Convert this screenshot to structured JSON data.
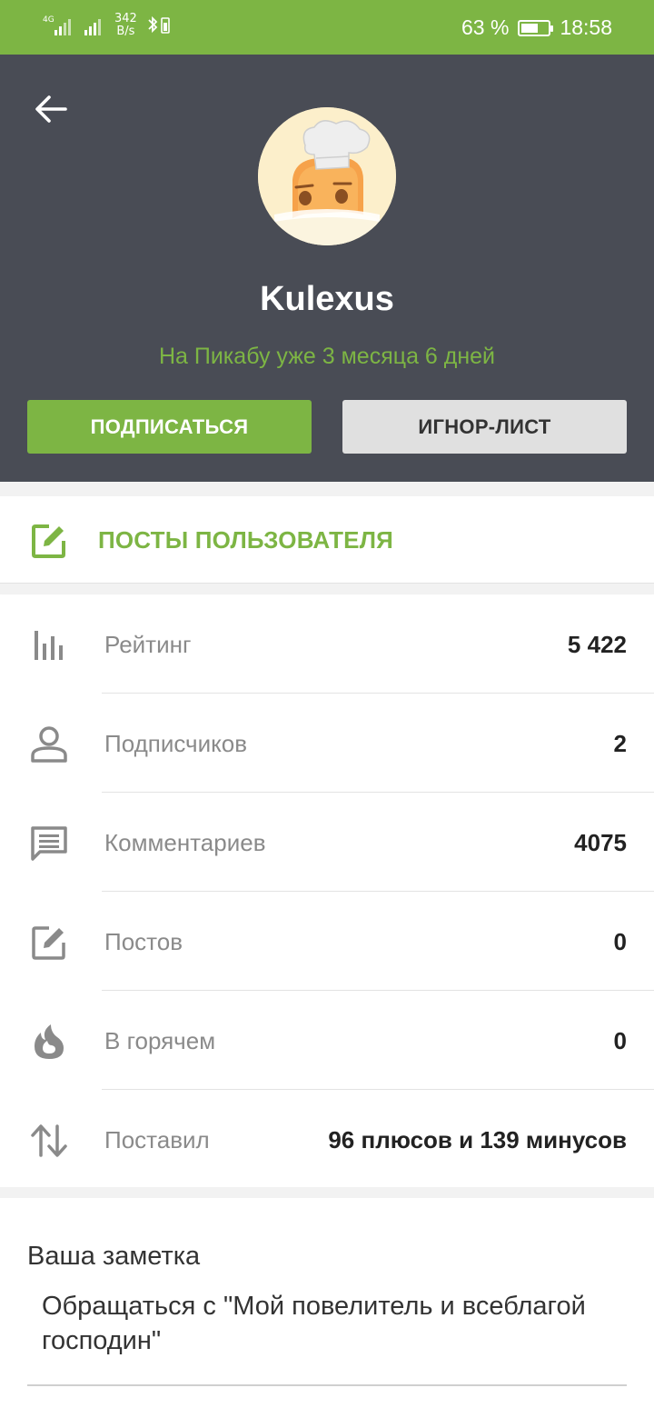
{
  "status_bar": {
    "network_speed_value": "342",
    "network_speed_unit": "B/s",
    "signal_label": "4G",
    "battery": "63 %",
    "battery_level": 0.63,
    "time": "18:58"
  },
  "profile": {
    "username": "Kulexus",
    "member_since": "На Пикабу уже 3 месяца 6 дней",
    "subscribe_label": "ПОДПИСАТЬСЯ",
    "ignore_label": "ИГНОР-ЛИСТ"
  },
  "posts_link": {
    "label": "ПОСТЫ ПОЛЬЗОВАТЕЛЯ",
    "icon": "edit-icon"
  },
  "stats": [
    {
      "icon": "bar-chart-icon",
      "label": "Рейтинг",
      "value": "5 422"
    },
    {
      "icon": "person-icon",
      "label": "Подписчиков",
      "value": "2"
    },
    {
      "icon": "comment-icon",
      "label": "Комментариев",
      "value": "4075"
    },
    {
      "icon": "edit-icon",
      "label": "Постов",
      "value": "0"
    },
    {
      "icon": "flame-icon",
      "label": "В горячем",
      "value": "0"
    },
    {
      "icon": "swap-vertical-icon",
      "label": "Поставил",
      "value": "96 плюсов и 139 минусов"
    }
  ],
  "note": {
    "title": "Ваша заметка",
    "text": "Обращаться с \"Мой повелитель и всеблагой господин\""
  },
  "colors": {
    "accent": "#7db544",
    "header_bg": "#494c55",
    "secondary_button": "#e0e0e0"
  }
}
